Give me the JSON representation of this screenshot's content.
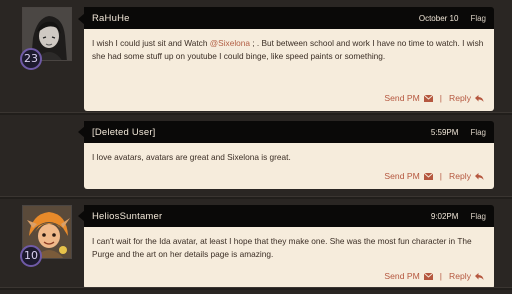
{
  "comments": [
    {
      "username": "RaHuHe",
      "time": "October 10",
      "flag_label": "Flag",
      "level": "23",
      "text_before": "I wish I could just sit and Watch ",
      "mention": "@Sixelona",
      "text_after": " ; . But between school and work I have no time to watch. I wish she had some stuff up on youtube I could binge, like speed paints or something.",
      "send_pm_label": "Send PM",
      "reply_label": "Reply"
    },
    {
      "username": "[Deleted User]",
      "time": "5:59PM",
      "flag_label": "Flag",
      "text": "I love avatars, avatars are great and Sixelona is great.",
      "send_pm_label": "Send PM",
      "reply_label": "Reply"
    },
    {
      "username": "HeliosSuntamer",
      "time": "9:02PM",
      "flag_label": "Flag",
      "level": "10",
      "text": "I can't wait for the Ida avatar, at least I hope that they make one. She was the most fun character in The Purge and the art on her details page is amazing.",
      "send_pm_label": "Send PM",
      "reply_label": "Reply"
    }
  ],
  "colors": {
    "background": "#2a2623",
    "header": "#0a0908",
    "body": "#f6ecdc",
    "link": "#b5573f",
    "level_ring": "#6f5aa6"
  },
  "icons": [
    "envelope-icon",
    "reply-arrow-icon",
    "avatar-portrait"
  ]
}
